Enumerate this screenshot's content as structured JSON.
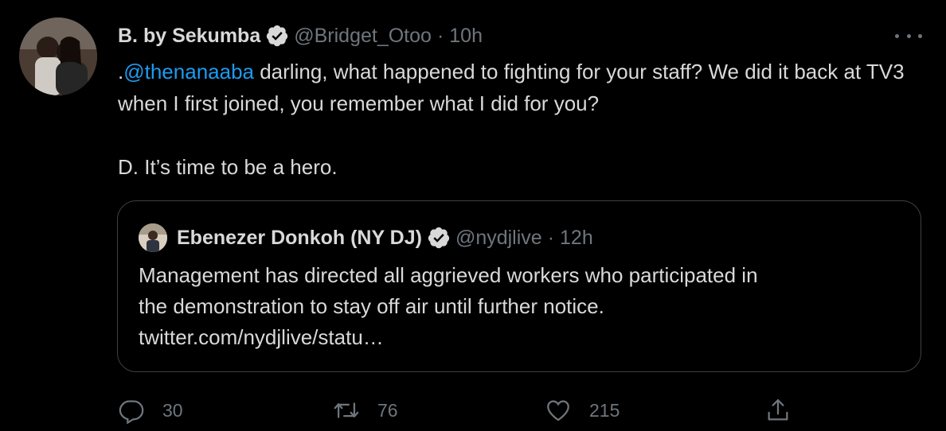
{
  "tweet": {
    "display_name": "B. by Sekumba",
    "handle": "@Bridget_Otoo",
    "separator": "·",
    "time": "10h",
    "body": {
      "line1_prefix": ".",
      "mention": "@thenanaaba",
      "line1_rest": " darling, what happened to fighting for your staff? We did it back at TV3 when I first joined, you remember what I did for you?",
      "line2": "D. It’s time to be a hero."
    }
  },
  "quoted_tweet": {
    "display_name": "Ebenezer Donkoh (NY DJ)",
    "handle": "@nydjlive",
    "separator": "·",
    "time": "12h",
    "text_line1": "Management has directed all aggrieved workers who participated in",
    "text_line2": "the demonstration to stay off air until further notice.",
    "text_line3": "twitter.com/nydjlive/statu…"
  },
  "actions": {
    "reply_count": "30",
    "retweet_count": "76",
    "like_count": "215"
  },
  "icons": {
    "verified": "verified-badge-icon",
    "more": "more-dots-icon",
    "reply": "reply-icon",
    "retweet": "retweet-icon",
    "like": "heart-icon",
    "share": "share-icon"
  },
  "colors": {
    "background": "#000000",
    "text": "#d9d9d9",
    "muted": "#6e767d",
    "link": "#1d9bf0",
    "border": "#3d4146"
  }
}
